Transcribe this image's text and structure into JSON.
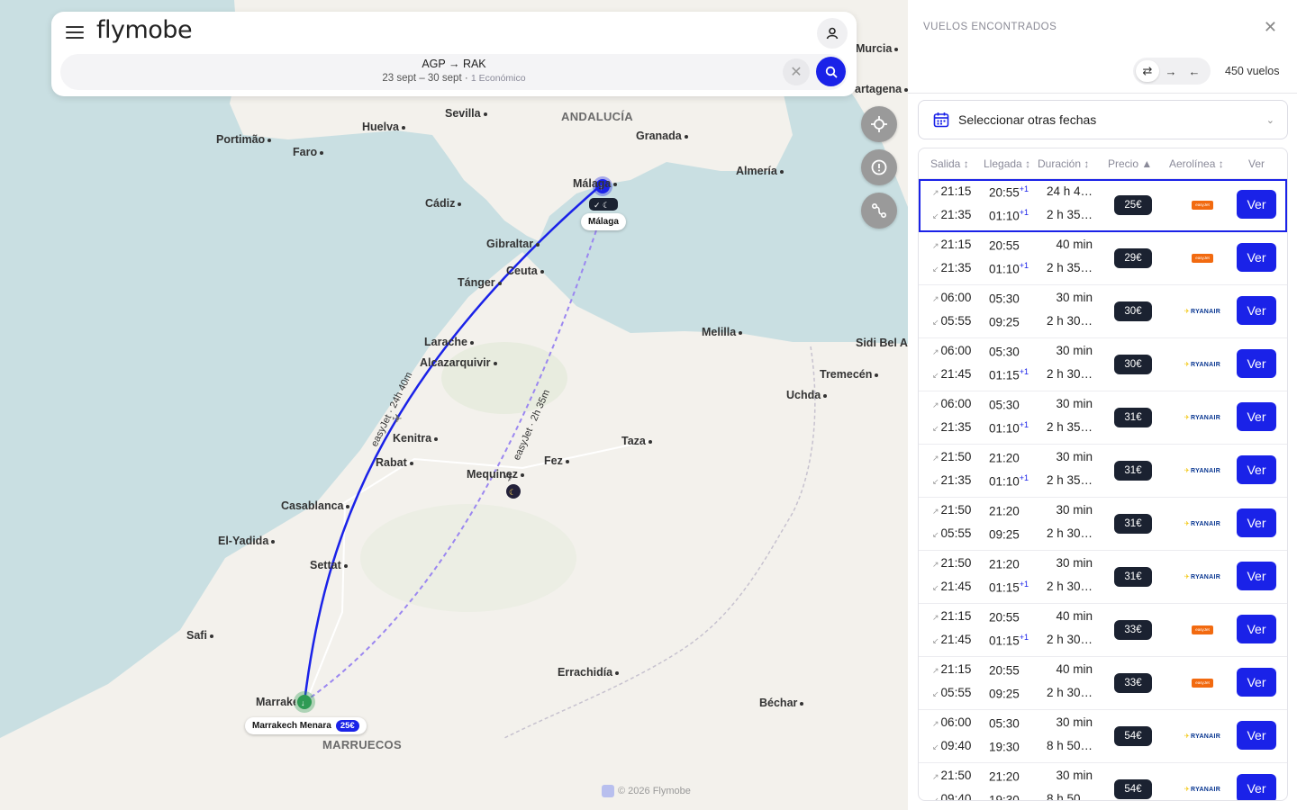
{
  "app": {
    "logo_text": "flymobe"
  },
  "search": {
    "route": "AGP → RAK",
    "dates": "23 sept – 30 sept",
    "cabin": "1 Económico"
  },
  "map": {
    "places": [
      "Portimão",
      "Faro",
      "Huelva",
      "Sevilla",
      "ANDALUCÍA",
      "Granada",
      "Almería",
      "Murcia",
      "Cartagena",
      "Cádiz",
      "Gibraltar",
      "Ceuta",
      "Tánger",
      "Málaga",
      "Melilla",
      "Sidi Bel Al",
      "Tremecén",
      "Uchda",
      "Larache",
      "Alcazarquivir",
      "Kenitra",
      "Rabat",
      "Taza",
      "Fez",
      "Mequinez",
      "Casablanca",
      "El-Yadida",
      "Settat",
      "Safi",
      "Marrakech",
      "Errachidía",
      "Béchar",
      "MARRUECOS"
    ],
    "origin_label": "Málaga",
    "dest_label": "Marrakech Menara",
    "dest_price": "25€",
    "route_label_1": "easyJet · 24h 40m",
    "route_label_2": "easyJet · 2h 35m",
    "copyright": "© 2026 Flymobe",
    "colors": {
      "solid_route": "#1a22e8",
      "dashed_route": "#9b87f0"
    }
  },
  "panel": {
    "title": "VUELOS ENCONTRADOS",
    "count": "450 vuelos",
    "date_select": "Seleccionar otras fechas",
    "headers": {
      "salida": "Salida",
      "llegada": "Llegada",
      "duracion": "Duración",
      "precio": "Precio",
      "aerolinea": "Aerolínea",
      "ver": "Ver"
    },
    "ver_label": "Ver",
    "rows": [
      {
        "d1": "21:15",
        "a1": "20:55",
        "a1p": "+1",
        "du1": "24 h 4…",
        "d2": "21:35",
        "a2": "01:10",
        "a2p": "+1",
        "du2": "2 h 35…",
        "price": "25€",
        "airline": "easyjet",
        "selected": true
      },
      {
        "d1": "21:15",
        "a1": "20:55",
        "a1p": "",
        "du1": "40 min",
        "d2": "21:35",
        "a2": "01:10",
        "a2p": "+1",
        "du2": "2 h 35…",
        "price": "29€",
        "airline": "easyjet"
      },
      {
        "d1": "06:00",
        "a1": "05:30",
        "a1p": "",
        "du1": "30 min",
        "d2": "05:55",
        "a2": "09:25",
        "a2p": "",
        "du2": "2 h 30…",
        "price": "30€",
        "airline": "ryanair"
      },
      {
        "d1": "06:00",
        "a1": "05:30",
        "a1p": "",
        "du1": "30 min",
        "d2": "21:45",
        "a2": "01:15",
        "a2p": "+1",
        "du2": "2 h 30…",
        "price": "30€",
        "airline": "ryanair"
      },
      {
        "d1": "06:00",
        "a1": "05:30",
        "a1p": "",
        "du1": "30 min",
        "d2": "21:35",
        "a2": "01:10",
        "a2p": "+1",
        "du2": "2 h 35…",
        "price": "31€",
        "airline": "ryanair"
      },
      {
        "d1": "21:50",
        "a1": "21:20",
        "a1p": "",
        "du1": "30 min",
        "d2": "21:35",
        "a2": "01:10",
        "a2p": "+1",
        "du2": "2 h 35…",
        "price": "31€",
        "airline": "ryanair"
      },
      {
        "d1": "21:50",
        "a1": "21:20",
        "a1p": "",
        "du1": "30 min",
        "d2": "05:55",
        "a2": "09:25",
        "a2p": "",
        "du2": "2 h 30…",
        "price": "31€",
        "airline": "ryanair"
      },
      {
        "d1": "21:50",
        "a1": "21:20",
        "a1p": "",
        "du1": "30 min",
        "d2": "21:45",
        "a2": "01:15",
        "a2p": "+1",
        "du2": "2 h 30…",
        "price": "31€",
        "airline": "ryanair"
      },
      {
        "d1": "21:15",
        "a1": "20:55",
        "a1p": "",
        "du1": "40 min",
        "d2": "21:45",
        "a2": "01:15",
        "a2p": "+1",
        "du2": "2 h 30…",
        "price": "33€",
        "airline": "easyjet"
      },
      {
        "d1": "21:15",
        "a1": "20:55",
        "a1p": "",
        "du1": "40 min",
        "d2": "05:55",
        "a2": "09:25",
        "a2p": "",
        "du2": "2 h 30…",
        "price": "33€",
        "airline": "easyjet"
      },
      {
        "d1": "06:00",
        "a1": "05:30",
        "a1p": "",
        "du1": "30 min",
        "d2": "09:40",
        "a2": "19:30",
        "a2p": "",
        "du2": "8 h 50…",
        "price": "54€",
        "airline": "ryanair"
      },
      {
        "d1": "21:50",
        "a1": "21:20",
        "a1p": "",
        "du1": "30 min",
        "d2": "09:40",
        "a2": "19:30",
        "a2p": "",
        "du2": "8 h 50…",
        "price": "54€",
        "airline": "ryanair"
      }
    ]
  }
}
